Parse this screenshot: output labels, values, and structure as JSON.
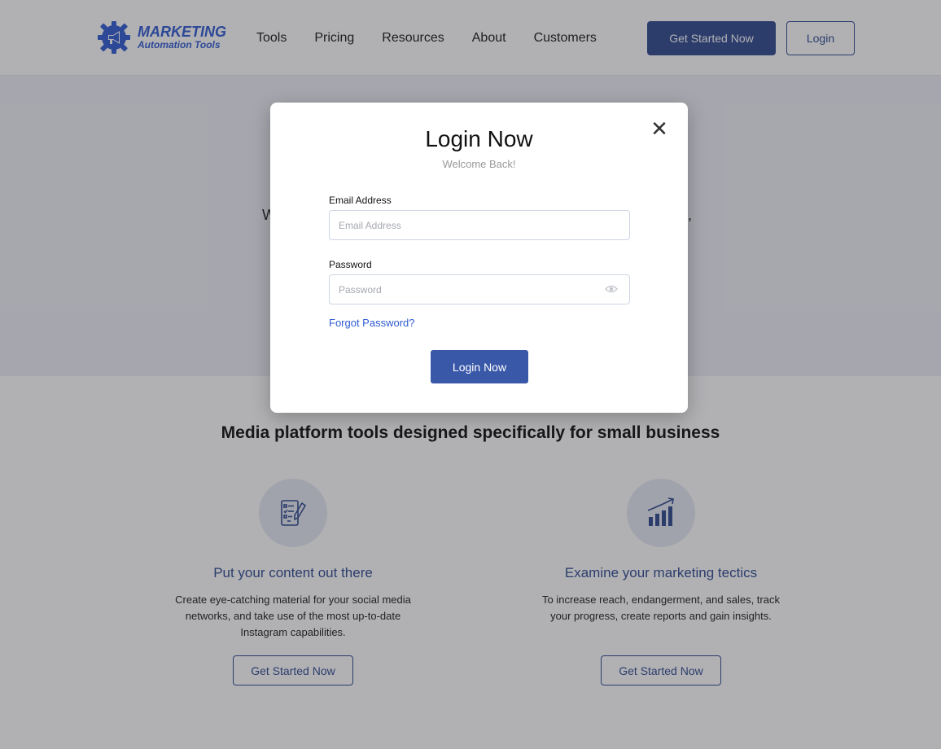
{
  "brand": {
    "title": "MARKETING",
    "subtitle": "Automation Tools",
    "color": "#2f5bd0"
  },
  "nav": {
    "links": [
      "Tools",
      "Pricing",
      "Resources",
      "About",
      "Customers"
    ],
    "cta_label": "Get Started Now",
    "login_label": "Login"
  },
  "hero": {
    "partial_left": "W",
    "partial_right": ","
  },
  "features": {
    "heading": "Media platform tools designed specifically for small business",
    "items": [
      {
        "icon": "checklist-pencil-icon",
        "title": "Put your content out there",
        "desc_lines": [
          "Create eye-catching material for your social media",
          "networks, and take use of the most up-to-date",
          "Instagram capabilities."
        ],
        "button": "Get Started Now"
      },
      {
        "icon": "growth-chart-icon",
        "title": "Examine your marketing tectics",
        "desc_lines": [
          "To increase reach, endangerment, and sales, track",
          "your progress, create reports and gain insights."
        ],
        "button": "Get Started Now"
      }
    ]
  },
  "modal": {
    "title": "Login Now",
    "subtitle": "Welcome Back!",
    "close_icon": "close-icon",
    "email_label": "Email Address",
    "email_placeholder": "Email Address",
    "password_label": "Password",
    "password_placeholder": "Password",
    "forgot_label": "Forgot Password?",
    "submit_label": "Login Now"
  },
  "colors": {
    "primary": "#2f4a8f",
    "modal_button": "#3a58a8",
    "overlay": "rgba(40,40,46,0.36)"
  }
}
